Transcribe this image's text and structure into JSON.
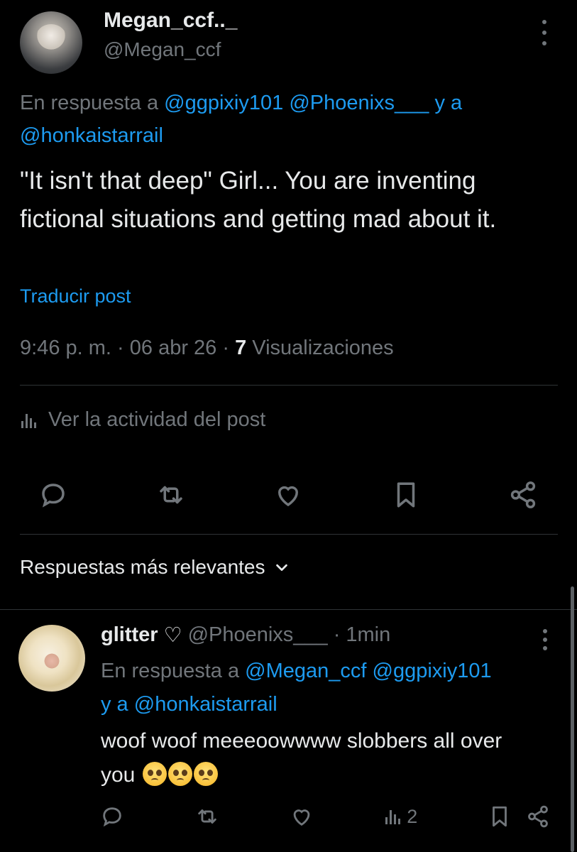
{
  "post": {
    "display_name": "Megan_ccf.._",
    "handle": "@Megan_ccf",
    "reply_prefix": "En respuesta a",
    "reply_mentions": [
      "@ggpixiy101",
      "@Phoenixs___",
      "@honkaistarrail"
    ],
    "reply_conjunction": "y a",
    "text": "\"It isn't that deep\" Girl... You are inventing fictional situations and getting mad about it.",
    "translate_label": "Traducir post",
    "time": "9:46 p. m.",
    "date": "06 abr 26",
    "views_count": "7",
    "views_label": "Visualizaciones",
    "activity_label": "Ver la actividad del post"
  },
  "replies_sort": {
    "label": "Respuestas más relevantes"
  },
  "reply": {
    "display_name": "glitter",
    "name_suffix": "♡",
    "handle": "@Phoenixs___",
    "separator": "·",
    "time": "1min",
    "reply_prefix": "En respuesta a",
    "reply_mentions": [
      "@Megan_ccf",
      "@ggpixiy101",
      "@honkaistarrail"
    ],
    "reply_conjunction": "y a",
    "text": "woof woof meeeoowwww slobbers all over you",
    "views_count": "2"
  },
  "colors": {
    "background": "#000000",
    "text": "#e7e9ea",
    "muted": "#71767b",
    "link": "#1d9bf0",
    "divider": "#2f3336"
  },
  "icons": [
    "more-vertical-icon",
    "analytics-icon",
    "reply-icon",
    "retweet-icon",
    "like-icon",
    "bookmark-icon",
    "share-icon",
    "chevron-down-icon",
    "pleading-face-emoji"
  ]
}
